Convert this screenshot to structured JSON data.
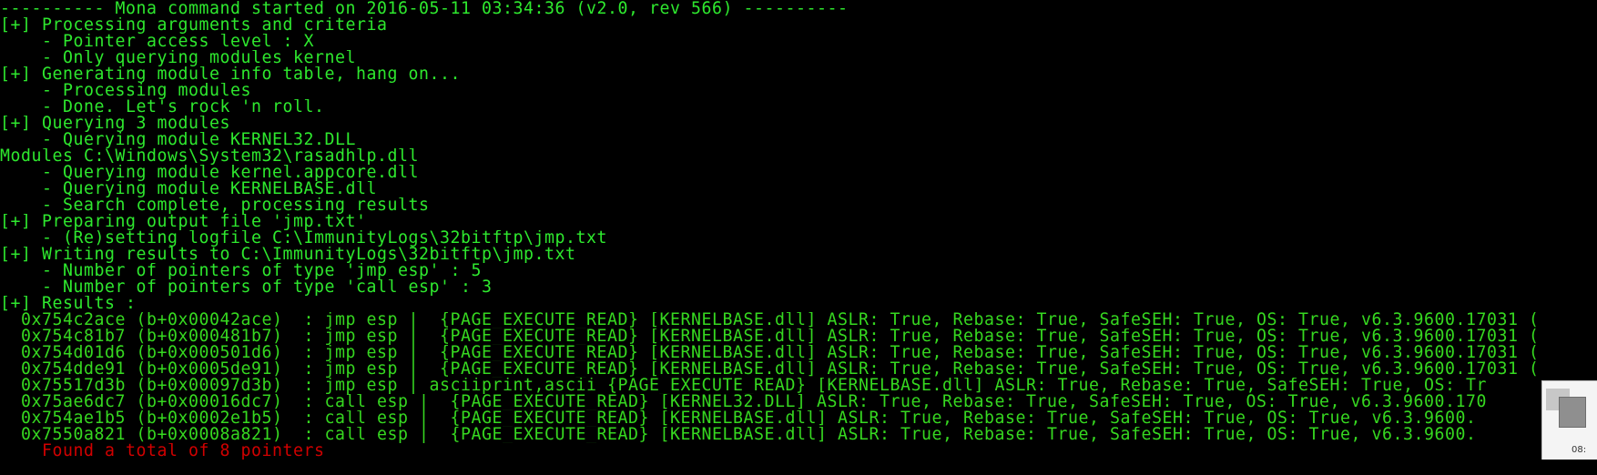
{
  "terminal": {
    "lines": [
      {
        "text": "---------- Mona command started on 2016-05-11 03:34:36 (v2.0, rev 566) ----------",
        "color": "#2ee82e"
      },
      {
        "text": "[+] Processing arguments and criteria",
        "color": "#2ee82e"
      },
      {
        "text": "    - Pointer access level : X",
        "color": "#2ee82e"
      },
      {
        "text": "    - Only querying modules kernel",
        "color": "#2ee82e"
      },
      {
        "text": "[+] Generating module info table, hang on...",
        "color": "#2ee82e"
      },
      {
        "text": "    - Processing modules",
        "color": "#2ee82e"
      },
      {
        "text": "    - Done. Let's rock 'n roll.",
        "color": "#2ee82e"
      },
      {
        "text": "[+] Querying 3 modules",
        "color": "#2ee82e"
      },
      {
        "text": "    - Querying module KERNEL32.DLL",
        "color": "#2ee82e"
      },
      {
        "text": "Modules C:\\Windows\\System32\\rasadhlp.dll",
        "color": "#2ee82e"
      },
      {
        "text": "    - Querying module kernel.appcore.dll",
        "color": "#2ee82e"
      },
      {
        "text": "    - Querying module KERNELBASE.dll",
        "color": "#2ee82e"
      },
      {
        "text": "    - Search complete, processing results",
        "color": "#2ee82e"
      },
      {
        "text": "[+] Preparing output file 'jmp.txt'",
        "color": "#2ee82e"
      },
      {
        "text": "    - (Re)setting logfile C:\\ImmunityLogs\\32bitftp\\jmp.txt",
        "color": "#2ee82e"
      },
      {
        "text": "[+] Writing results to C:\\ImmunityLogs\\32bitftp\\jmp.txt",
        "color": "#2ee82e"
      },
      {
        "text": "    - Number of pointers of type 'jmp esp' : 5",
        "color": "#2ee82e"
      },
      {
        "text": "    - Number of pointers of type 'call esp' : 3",
        "color": "#2ee82e"
      },
      {
        "text": "[+] Results :",
        "color": "#2ee82e"
      },
      {
        "text": "  0x754c2ace (b+0x00042ace)  : jmp esp |  {PAGE_EXECUTE_READ} [KERNELBASE.dll] ASLR: True, Rebase: True, SafeSEH: True, OS: True, v6.3.9600.17031 (",
        "color": "#36d820"
      },
      {
        "text": "  0x754c81b7 (b+0x000481b7)  : jmp esp |  {PAGE_EXECUTE_READ} [KERNELBASE.dll] ASLR: True, Rebase: True, SafeSEH: True, OS: True, v6.3.9600.17031 (",
        "color": "#36d820"
      },
      {
        "text": "  0x754d01d6 (b+0x000501d6)  : jmp esp |  {PAGE_EXECUTE_READ} [KERNELBASE.dll] ASLR: True, Rebase: True, SafeSEH: True, OS: True, v6.3.9600.17031 (",
        "color": "#36d820"
      },
      {
        "text": "  0x754dde91 (b+0x0005de91)  : jmp esp |  {PAGE_EXECUTE_READ} [KERNELBASE.dll] ASLR: True, Rebase: True, SafeSEH: True, OS: True, v6.3.9600.17031 (",
        "color": "#36d820"
      },
      {
        "text": "  0x75517d3b (b+0x00097d3b)  : jmp esp | asciiprint,ascii {PAGE_EXECUTE_READ} [KERNELBASE.dll] ASLR: True, Rebase: True, SafeSEH: True, OS: Tr",
        "color": "#36d820"
      },
      {
        "text": "  0x75ae6dc7 (b+0x00016dc7)  : call esp |  {PAGE_EXECUTE_READ} [KERNEL32.DLL] ASLR: True, Rebase: True, SafeSEH: True, OS: True, v6.3.9600.170",
        "color": "#36d820"
      },
      {
        "text": "  0x754ae1b5 (b+0x0002e1b5)  : call esp |  {PAGE_EXECUTE_READ} [KERNELBASE.dll] ASLR: True, Rebase: True, SafeSEH: True, OS: True, v6.3.9600.",
        "color": "#36d820"
      },
      {
        "text": "  0x7550a821 (b+0x0008a821)  : call esp |  {PAGE_EXECUTE_READ} [KERNELBASE.dll] ASLR: True, Rebase: True, SafeSEH: True, OS: True, v6.3.9600.",
        "color": "#36d820"
      },
      {
        "text": "    Found a total of 8 pointers",
        "color": "#d00000"
      }
    ]
  },
  "tray_popup": {
    "time": "08:"
  },
  "colors": {
    "background": "#000000",
    "log_text": "#2ee82e",
    "result_text": "#36d820",
    "summary_text": "#d00000"
  }
}
